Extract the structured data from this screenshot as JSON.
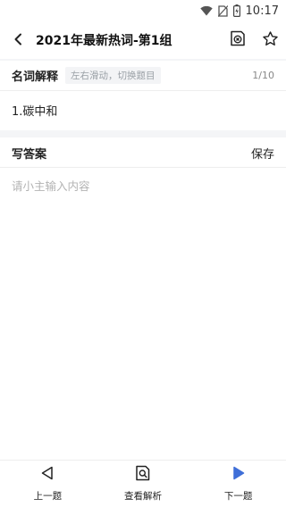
{
  "status_bar": {
    "time": "10:17",
    "icons": [
      "wifi-icon",
      "no-sim-icon",
      "battery-icon"
    ]
  },
  "header": {
    "title": "2021年最新热词-第1组",
    "icons": [
      "back-arrow-icon",
      "answer-sheet-icon",
      "star-icon"
    ]
  },
  "term_section": {
    "label": "名词解释",
    "hint": "左右滑动，切换题目",
    "page_indicator": "1/10"
  },
  "question": {
    "text": "1.碳中和"
  },
  "answer_section": {
    "label": "写答案",
    "save_label": "保存",
    "input_placeholder": "请小主输入内容",
    "input_value": ""
  },
  "bottom_nav": {
    "items": [
      {
        "label": "上一题",
        "icon": "prev-triangle-icon"
      },
      {
        "label": "查看解析",
        "icon": "view-analysis-icon"
      },
      {
        "label": "下一题",
        "icon": "next-triangle-icon"
      }
    ]
  },
  "colors": {
    "accent": "#3f6fd8",
    "section_gap": "#f4f5f7",
    "placeholder": "#b3b3b3"
  }
}
